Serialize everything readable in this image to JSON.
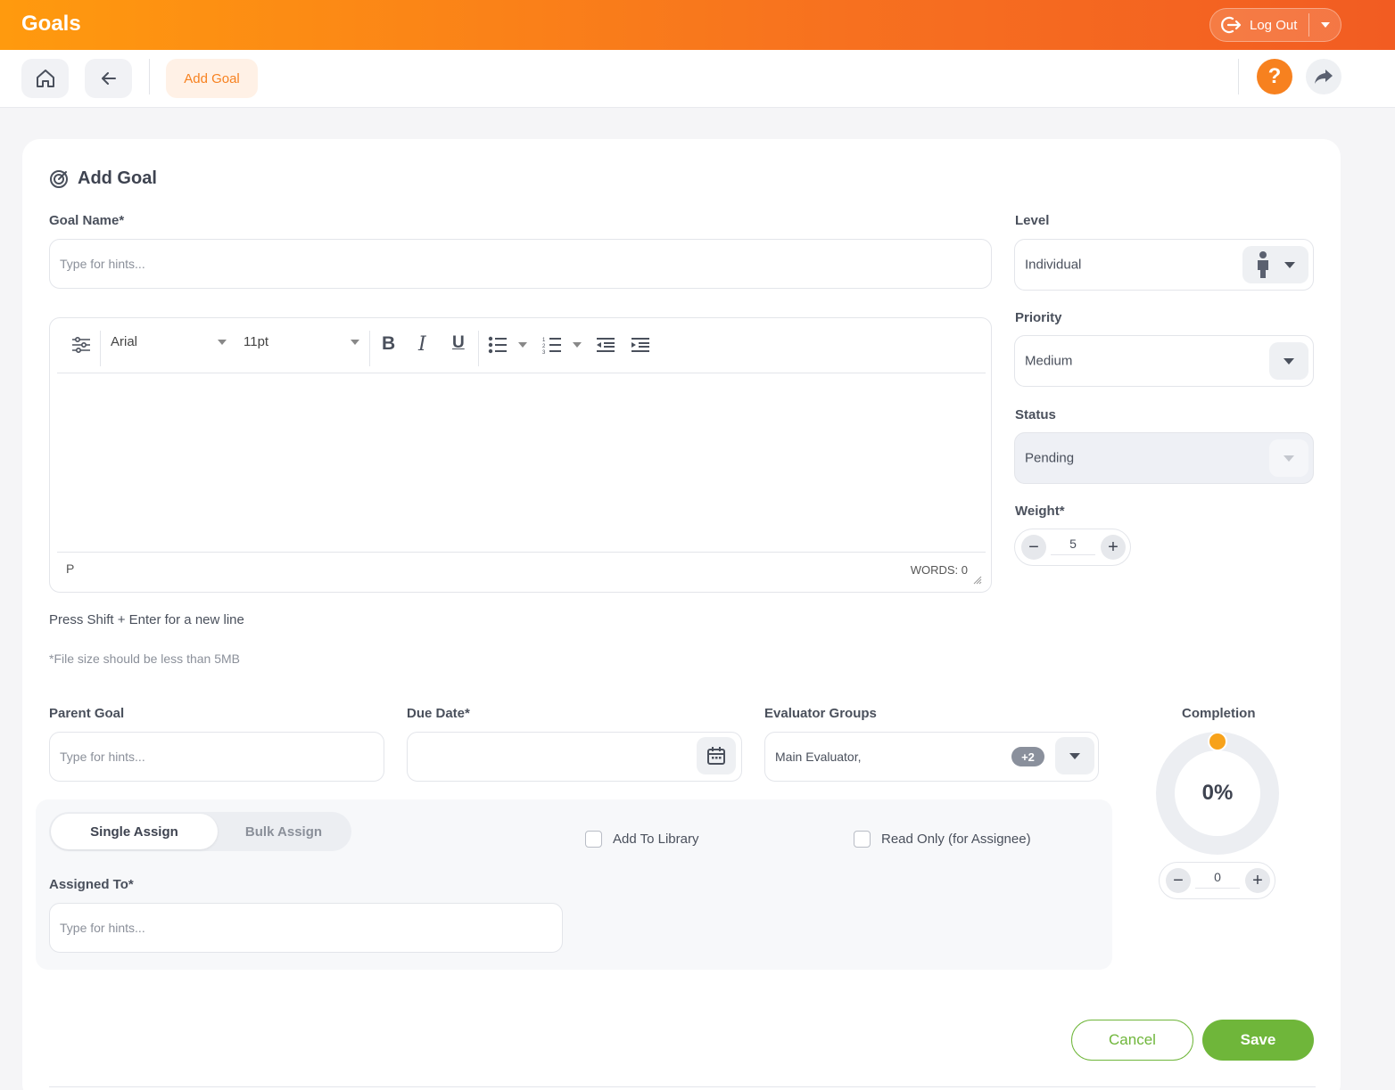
{
  "header": {
    "title": "Goals",
    "logout_label": "Log Out"
  },
  "nav": {
    "breadcrumb": "Add Goal",
    "help_label": "?"
  },
  "form": {
    "heading": "Add Goal",
    "goal_name": {
      "label": "Goal Name*",
      "placeholder": "Type for hints..."
    },
    "editor": {
      "font": "Arial",
      "size": "11pt",
      "bold": "B",
      "italic": "I",
      "underline": "U",
      "path": "P",
      "words": "WORDS: 0"
    },
    "hint_newline": "Press Shift + Enter for a new line",
    "hint_file": "*File size should be less than 5MB",
    "level": {
      "label": "Level",
      "value": "Individual"
    },
    "priority": {
      "label": "Priority",
      "value": "Medium"
    },
    "status": {
      "label": "Status",
      "value": "Pending"
    },
    "weight": {
      "label": "Weight*",
      "value": "5",
      "minus": "−",
      "plus": "+"
    },
    "parent_goal": {
      "label": "Parent Goal",
      "placeholder": "Type for hints..."
    },
    "due_date": {
      "label": "Due Date*"
    },
    "evaluator_groups": {
      "label": "Evaluator Groups",
      "value": "Main Evaluator,",
      "extra_badge": "+2"
    },
    "completion": {
      "label": "Completion",
      "percent_text": "0%",
      "value": "0",
      "minus": "−",
      "plus": "+",
      "progress": 0
    },
    "assign_tabs": {
      "single": "Single Assign",
      "bulk": "Bulk Assign",
      "active": "single"
    },
    "add_to_library": "Add To Library",
    "read_only": "Read Only (for Assignee)",
    "assigned_to": {
      "label": "Assigned To*",
      "placeholder": "Type for hints..."
    },
    "cancel_label": "Cancel",
    "save_label": "Save"
  },
  "colors": {
    "accent_orange": "#f7811f",
    "save_green": "#6fb63a",
    "completion_knob": "#f7a21b"
  }
}
